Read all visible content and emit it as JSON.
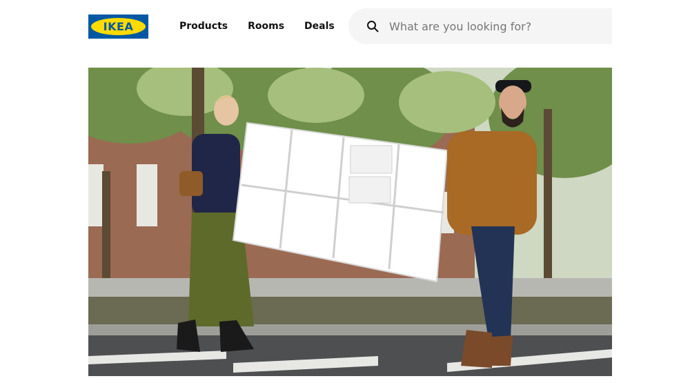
{
  "brand": {
    "logo_text": "IKEA",
    "colors": {
      "blue": "#0058a3",
      "yellow": "#ffdb00"
    }
  },
  "nav": {
    "items": [
      {
        "label": "Products"
      },
      {
        "label": "Rooms"
      },
      {
        "label": "Deals"
      }
    ]
  },
  "search": {
    "placeholder": "What are you looking for?",
    "icon": "search-icon"
  },
  "hero": {
    "description_icon": "photo"
  }
}
